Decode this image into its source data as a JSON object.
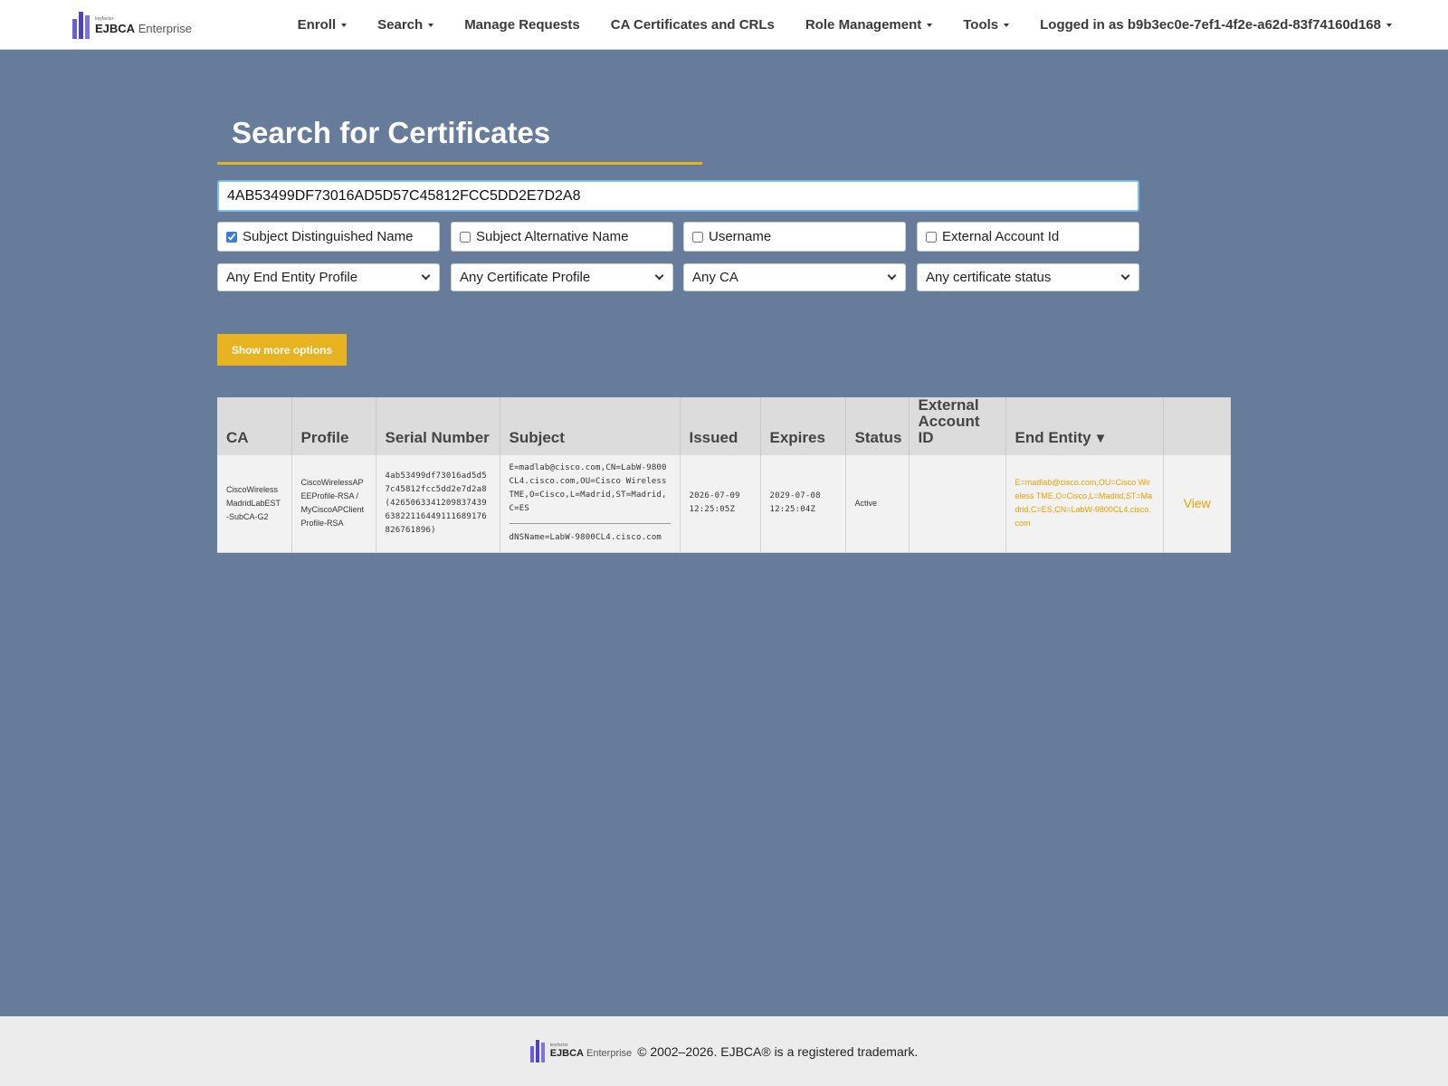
{
  "header": {
    "logo": {
      "tagline": "keyfactor",
      "name_bold": "EJBCA",
      "name_light": " Enterprise"
    },
    "nav": [
      {
        "label": "Enroll",
        "dropdown": true
      },
      {
        "label": "Search",
        "dropdown": true
      },
      {
        "label": "Manage Requests",
        "dropdown": false
      },
      {
        "label": "CA Certificates and CRLs",
        "dropdown": false
      },
      {
        "label": "Role Management",
        "dropdown": true
      },
      {
        "label": "Tools",
        "dropdown": true
      },
      {
        "label": "Logged in as b9b3ec0e-7ef1-4f2e-a62d-83f74160d168",
        "dropdown": true
      }
    ]
  },
  "page": {
    "title": "Search for Certificates"
  },
  "search": {
    "value": "4AB53499DF73016AD5D57C45812FCC5DD2E7D2A8"
  },
  "filters": {
    "checkboxes": [
      {
        "label": "Subject Distinguished Name",
        "checked": true
      },
      {
        "label": "Subject Alternative Name",
        "checked": false
      },
      {
        "label": "Username",
        "checked": false
      },
      {
        "label": "External Account Id",
        "checked": false
      }
    ],
    "selects": [
      {
        "selected": "Any End Entity Profile"
      },
      {
        "selected": "Any Certificate Profile"
      },
      {
        "selected": "Any CA"
      },
      {
        "selected": "Any certificate status"
      }
    ]
  },
  "more_options_label": "Show more options",
  "table": {
    "columns": [
      "CA",
      "Profile",
      "Serial Number",
      "Subject",
      "Issued",
      "Expires",
      "Status",
      "External Account ID",
      "End Entity",
      ""
    ],
    "sorted_column": "End Entity",
    "sort_indicator": "▼",
    "rows": [
      {
        "ca": "CiscoWirelessMadridLabEST-SubCA-G2",
        "profile": "CiscoWirelessAPEEProfile-RSA / MyCiscoAPClientProfile-RSA",
        "serial": "4ab53499df73016ad5d57c45812fcc5dd2e7d2a8 (426506334120983743963822116449111689176826761896)",
        "subject_dn": "E=madlab@cisco.com,CN=LabW-9800CL4.cisco.com,OU=Cisco Wireless TME,O=Cisco,L=Madrid,ST=Madrid,C=ES",
        "subject_alt": "dNSName=LabW-9800CL4.cisco.com",
        "issued_date": "2026-07-09",
        "issued_time": "12:25:05Z",
        "expires_date": "2029-07-08",
        "expires_time": "12:25:04Z",
        "status": "Active",
        "external_account_id": "",
        "end_entity": "E=madlab@cisco.com,OU=Cisco Wireless TME,O=Cisco,L=Madrid,ST=Madrid,C=ES,CN=LabW-9800CL4.cisco.com",
        "action": "View"
      }
    ]
  },
  "footer": {
    "text": "© 2002–2026. EJBCA® is a registered trademark."
  },
  "colors": {
    "accent": "#e8b321",
    "background": "#677b9a",
    "link": "#e8a000"
  }
}
